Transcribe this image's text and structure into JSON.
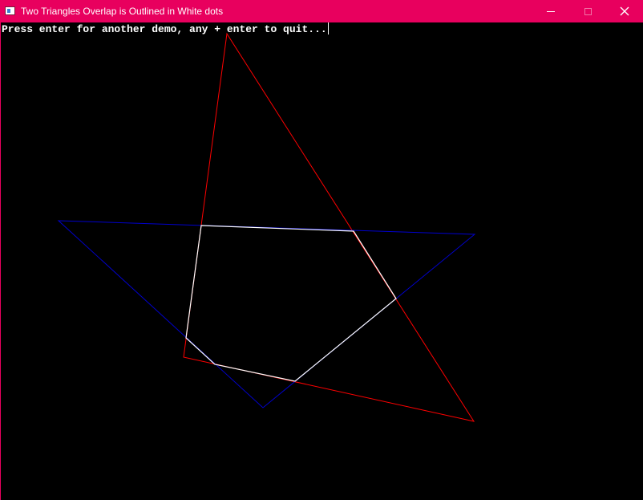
{
  "window": {
    "title": "Two Triangles Overlap is Outlined in White dots",
    "accent_color": "#e8005e",
    "icon": "console-app-icon",
    "controls": {
      "minimize_icon": "minimize-icon",
      "maximize_icon": "maximize-icon",
      "close_icon": "close-icon",
      "close_glyph": "✕"
    }
  },
  "console": {
    "prompt_text": "Press enter for another demo, any + enter to quit...",
    "background_color": "#000000",
    "text_color": "#ffffff"
  },
  "drawing": {
    "triangle_red_color": "#ff0000",
    "triangle_blue_color": "#0000cc",
    "overlap_outline_color": "#ffffff"
  }
}
